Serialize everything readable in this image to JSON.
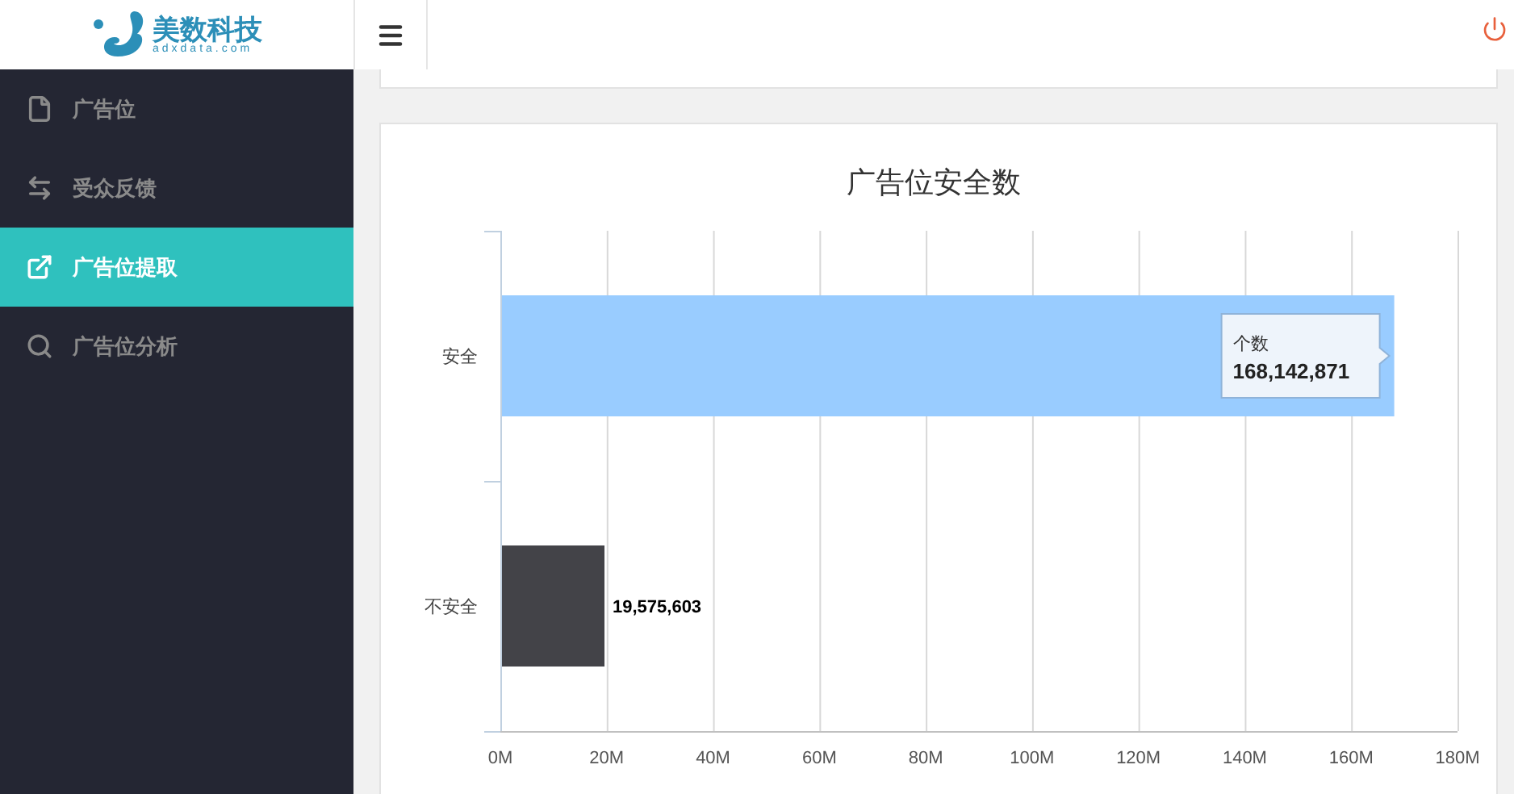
{
  "brand": {
    "name": "美数科技",
    "domain": "adxdata.com"
  },
  "sidebar": {
    "items": [
      {
        "label": "广告位",
        "selected": false
      },
      {
        "label": "受众反馈",
        "selected": false
      },
      {
        "label": "广告位提取",
        "selected": true
      },
      {
        "label": "广告位分析",
        "selected": false
      }
    ]
  },
  "chart": {
    "title": "广告位安全数",
    "tooltip": {
      "value": "168,142,871"
    },
    "chart_data": {
      "type": "bar",
      "orientation": "horizontal",
      "grid": true,
      "categories": [
        "安全",
        "不安全"
      ],
      "series": [
        {
          "name": "个数",
          "color": "#99ccff",
          "values": [
            168100000,
            null
          ]
        },
        {
          "color": "#434348",
          "values": [
            null,
            19580000
          ]
        }
      ],
      "xlim": [
        0,
        180000000
      ],
      "xticks": [
        {
          "value": 0,
          "label": "0M"
        },
        {
          "value": 20000000,
          "label": "20M"
        },
        {
          "value": 40000000,
          "label": "40M"
        },
        {
          "value": 60000000,
          "label": "60M"
        },
        {
          "value": 80000000,
          "label": "80M"
        },
        {
          "value": 100000000,
          "label": "100M"
        },
        {
          "value": 120000000,
          "label": "120M"
        },
        {
          "value": 140000000,
          "label": "140M"
        },
        {
          "value": 160000000,
          "label": "160M"
        },
        {
          "value": 180000000,
          "label": "180M"
        }
      ],
      "value_labels": [
        null,
        "19,575,603"
      ]
    }
  }
}
